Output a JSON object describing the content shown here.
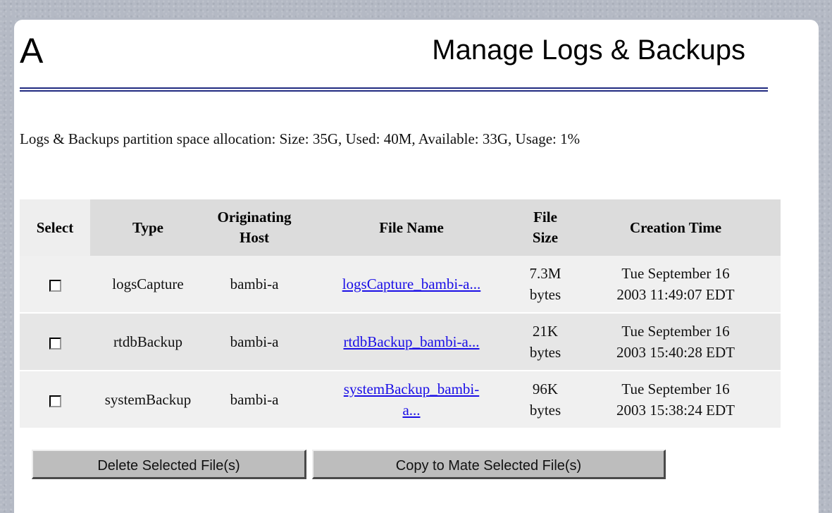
{
  "header": {
    "logo_letter": "A",
    "title": "Manage Logs & Backups"
  },
  "space_info": "Logs & Backups partition space allocation: Size: 35G, Used: 40M, Available: 33G, Usage: 1%",
  "table": {
    "headers": {
      "select": "Select",
      "type": "Type",
      "host_line1": "Originating",
      "host_line2": "Host",
      "file_name": "File Name",
      "size_line1": "File",
      "size_line2": "Size",
      "creation_time": "Creation Time"
    },
    "rows": [
      {
        "checked": false,
        "type": "logsCapture",
        "host": "bambi-a",
        "file_line1": "logsCapture_bambi-a...",
        "file_line2": "",
        "size_value": "7.3M",
        "size_unit": "bytes",
        "time_line1": "Tue September 16",
        "time_line2": "2003 11:49:07 EDT"
      },
      {
        "checked": false,
        "type": "rtdbBackup",
        "host": "bambi-a",
        "file_line1": "rtdbBackup_bambi-a...",
        "file_line2": "",
        "size_value": "21K",
        "size_unit": "bytes",
        "time_line1": "Tue September 16",
        "time_line2": "2003 15:40:28 EDT"
      },
      {
        "checked": false,
        "type": "systemBackup",
        "host": "bambi-a",
        "file_line1": "systemBackup_bambi-",
        "file_line2": "a...",
        "size_value": "96K",
        "size_unit": "bytes",
        "time_line1": "Tue September 16",
        "time_line2": "2003 15:38:24 EDT"
      }
    ]
  },
  "buttons": {
    "delete": "Delete Selected File(s)",
    "copy": "Copy to Mate Selected File(s)"
  },
  "colors": {
    "link": "#1a0ee6",
    "rule": "#202a80",
    "header_bg": "#dcdcdc",
    "row_bg": "#f0f0f0",
    "button_bg": "#bdbdbd"
  }
}
